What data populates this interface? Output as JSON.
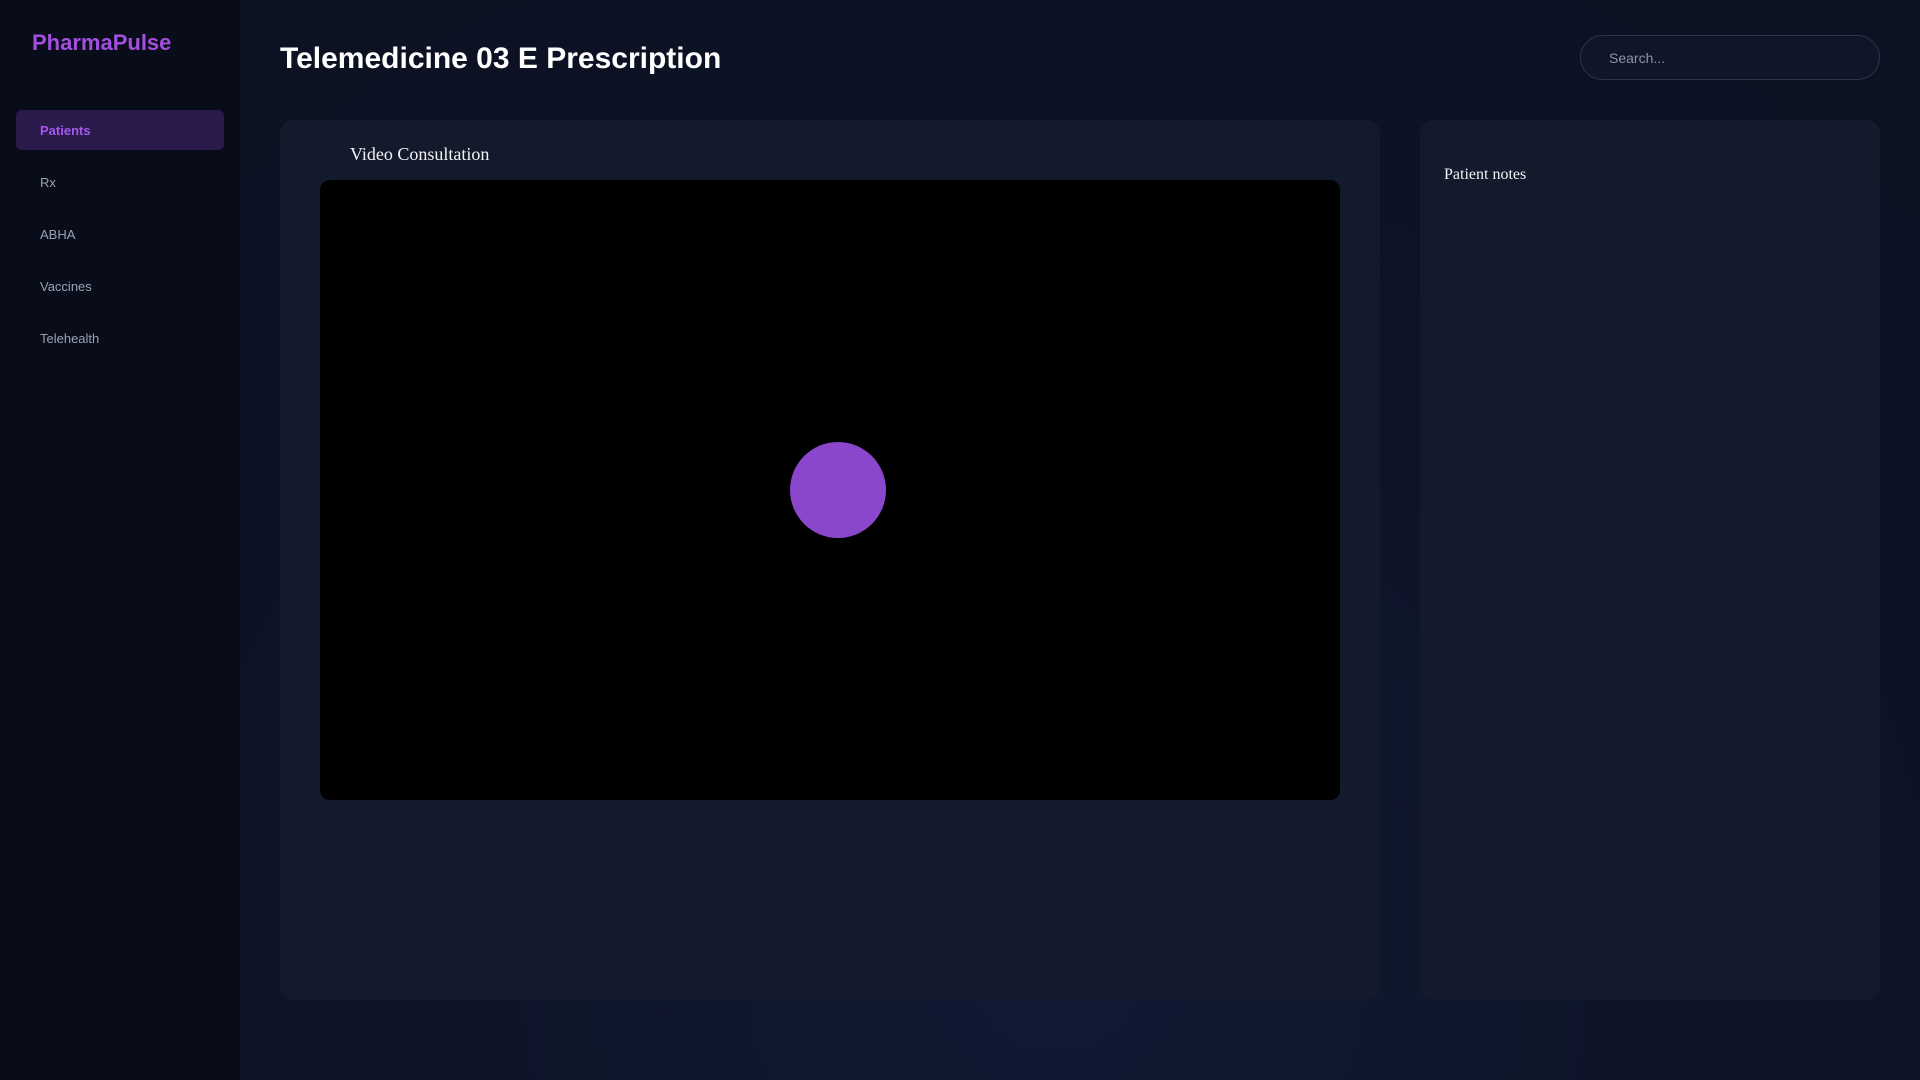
{
  "app": {
    "name": "PharmaPulse"
  },
  "sidebar": {
    "items": [
      {
        "label": "Patients",
        "active": true
      },
      {
        "label": "Rx",
        "active": false
      },
      {
        "label": "ABHA",
        "active": false
      },
      {
        "label": "Vaccines",
        "active": false
      },
      {
        "label": "Telehealth",
        "active": false
      }
    ]
  },
  "header": {
    "title": "Telemedicine 03 E Prescription",
    "search_placeholder": "Search..."
  },
  "video": {
    "title": "Video Consultation"
  },
  "notes": {
    "title": "Patient notes"
  },
  "colors": {
    "accent": "#a24fe0",
    "avatar": "#8a47cc",
    "active_nav_bg": "#2b1b4d",
    "background": "#0c1222",
    "card": "#131a2b"
  }
}
